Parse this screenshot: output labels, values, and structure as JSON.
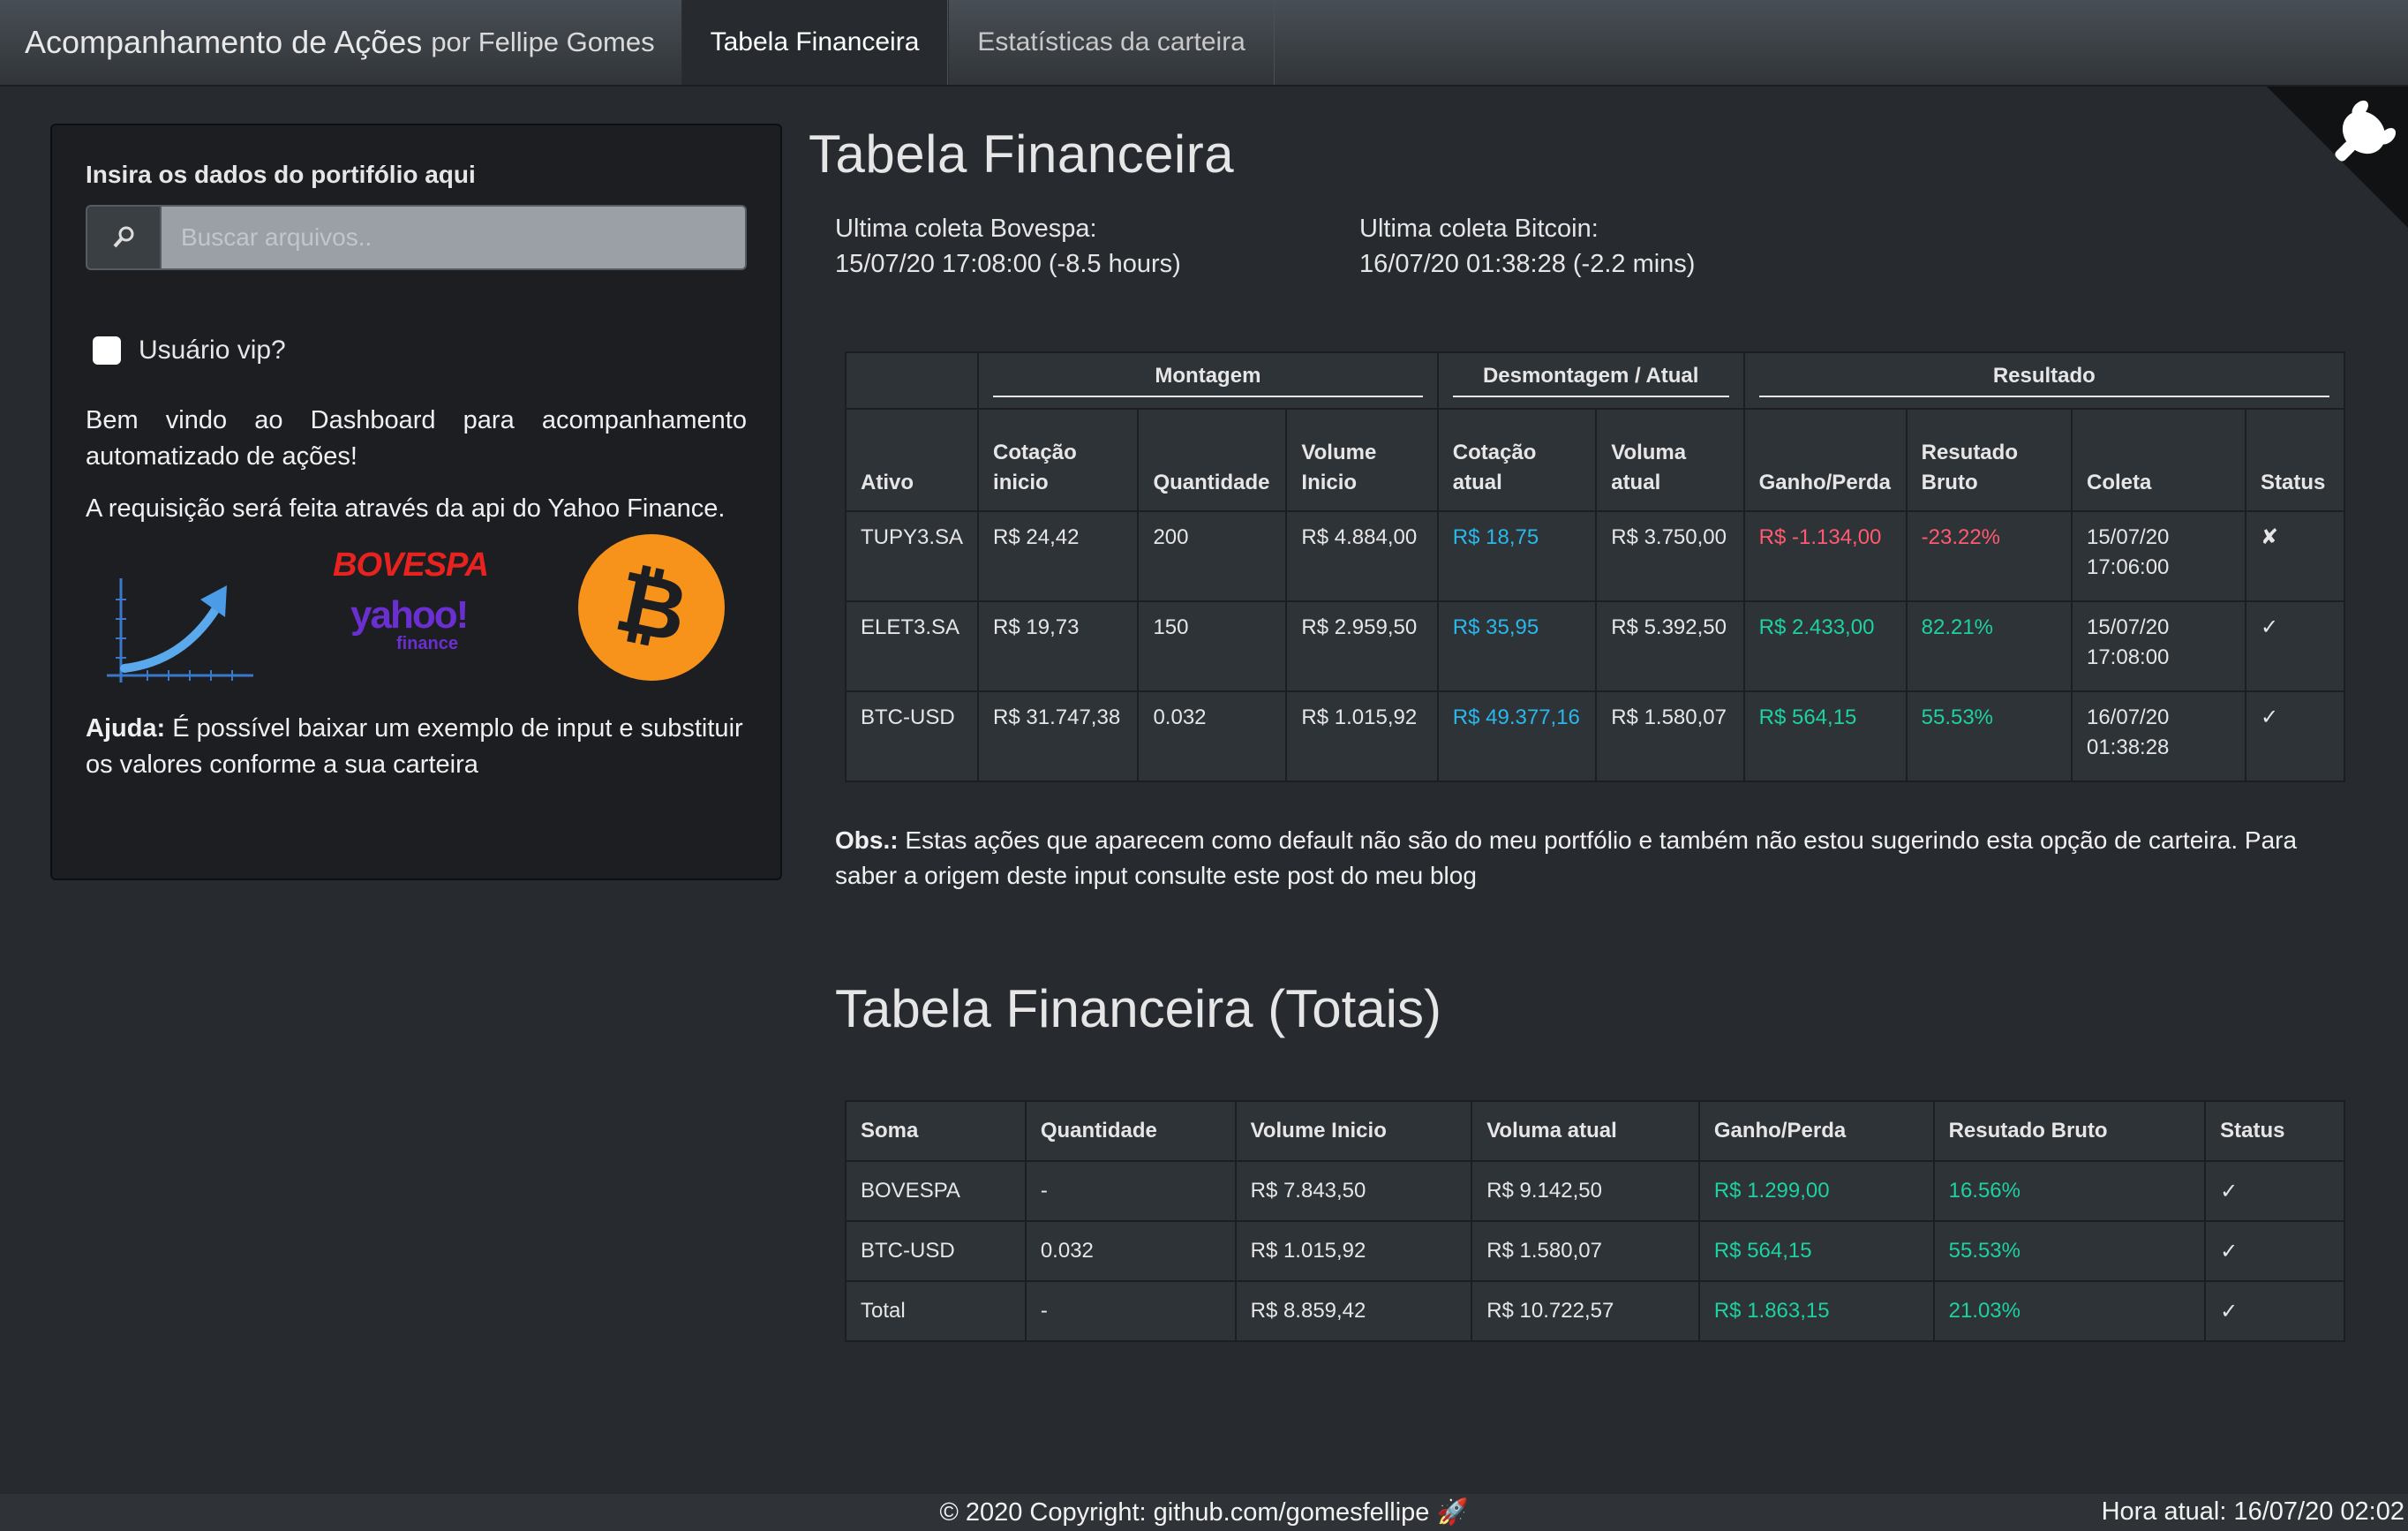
{
  "nav": {
    "brand": "Acompanhamento de Ações",
    "brand_by": "por Fellipe Gomes",
    "tabs": [
      {
        "label": "Tabela Financeira",
        "active": true
      },
      {
        "label": "Estatísticas da carteira",
        "active": false
      }
    ]
  },
  "sidebar": {
    "upload_label": "Insira os dados do portifólio aqui",
    "search_placeholder": "Buscar arquivos..",
    "vip_label": "Usuário vip?",
    "welcome": "Bem vindo ao Dashboard para acompanhamento automatizado de ações!",
    "request": "A requisição será feita através da api do Yahoo Finance.",
    "logos": {
      "bovespa": "BOVESPA",
      "yahoo": "yahoo!",
      "yahoo_sub": "finance",
      "bitcoin": "₿"
    },
    "help_bold": "Ajuda:",
    "help_text": "É possível baixar um exemplo de input e substituir os valores conforme a sua carteira"
  },
  "main": {
    "title": "Tabela Financeira",
    "collect_bovespa_label": "Ultima coleta Bovespa:",
    "collect_bovespa_value": "15/07/20 17:08:00 (-8.5 hours)",
    "collect_bitcoin_label": "Ultima coleta Bitcoin:",
    "collect_bitcoin_value": "16/07/20 01:38:28 (-2.2 mins)",
    "table": {
      "groups": [
        "Montagem",
        "Desmontagem / Atual",
        "Resultado"
      ],
      "headers": [
        "Ativo",
        "Cotação inicio",
        "Quantidade",
        "Volume Inicio",
        "Cotação atual",
        "Voluma atual",
        "Ganho/Perda",
        "Resutado Bruto",
        "Coleta",
        "Status"
      ],
      "rows": [
        {
          "ativo": "TUPY3.SA",
          "cot_inicio": "R$  24,42",
          "qtd": "200",
          "vol_inicio": "R$ 4.884,00",
          "cot_atual": "R$  18,75",
          "vol_atual": "R$ 3.750,00",
          "ganho": "R$ -1.134,00",
          "bruto": "-23.22%",
          "coleta1": "15/07/20",
          "coleta2": "17:06:00",
          "status": "✘",
          "trend": "red"
        },
        {
          "ativo": "ELET3.SA",
          "cot_inicio": "R$  19,73",
          "qtd": "150",
          "vol_inicio": "R$ 2.959,50",
          "cot_atual": "R$  35,95",
          "vol_atual": "R$ 5.392,50",
          "ganho": "R$  2.433,00",
          "bruto": "82.21%",
          "coleta1": "15/07/20",
          "coleta2": "17:08:00",
          "status": "✓",
          "trend": "green"
        },
        {
          "ativo": "BTC-USD",
          "cot_inicio": "R$ 31.747,38",
          "qtd": "0.032",
          "vol_inicio": "R$ 1.015,92",
          "cot_atual": "R$ 49.377,16",
          "vol_atual": "R$ 1.580,07",
          "ganho": "R$  564,15",
          "bruto": "55.53%",
          "coleta1": "16/07/20",
          "coleta2": "01:38:28",
          "status": "✓",
          "trend": "green"
        }
      ]
    },
    "obs_bold": "Obs.:",
    "obs_text": "Estas ações que aparecem como default não são do meu portfólio e também não estou sugerindo esta opção de carteira. Para saber a origem deste input consulte este post do meu blog",
    "totals_title": "Tabela Financeira (Totais)",
    "totals": {
      "headers": [
        "Soma",
        "Quantidade",
        "Volume Inicio",
        "Voluma atual",
        "Ganho/Perda",
        "Resutado Bruto",
        "Status"
      ],
      "rows": [
        {
          "soma": "BOVESPA",
          "qtd": "-",
          "vol_inicio": "R$ 7.843,50",
          "vol_atual": "R$  9.142,50",
          "ganho": "R$ 1.299,00",
          "bruto": "16.56%",
          "status": "✓"
        },
        {
          "soma": "BTC-USD",
          "qtd": "0.032",
          "vol_inicio": "R$ 1.015,92",
          "vol_atual": "R$  1.580,07",
          "ganho": "R$  564,15",
          "bruto": "55.53%",
          "status": "✓"
        },
        {
          "soma": "Total",
          "qtd": "-",
          "vol_inicio": "R$ 8.859,42",
          "vol_atual": "R$ 10.722,57",
          "ganho": "R$ 1.863,15",
          "bruto": "21.03%",
          "status": "✓"
        }
      ]
    }
  },
  "footer": {
    "copyright": "© 2020 Copyright: github.com/gomesfellipe 🚀",
    "clock": "Hora atual: 16/07/20 02:02"
  },
  "colors": {
    "positive": "#1dd1a1",
    "negative": "#ff5a6e",
    "quote": "#2ab7ea",
    "bitcoin": "#f7931a"
  }
}
